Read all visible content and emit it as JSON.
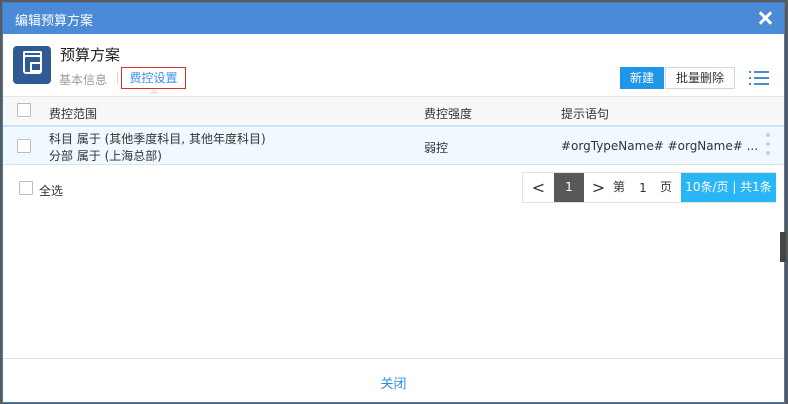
{
  "dialog": {
    "title": "编辑预算方案",
    "close_icon": "close-icon"
  },
  "header": {
    "page_title": "预算方案",
    "tabs": [
      {
        "label": "基本信息",
        "active": false
      },
      {
        "label": "费控设置",
        "active": true
      }
    ],
    "new_button": "新建",
    "batch_delete_button": "批量删除",
    "menu_icon": "list-menu-icon"
  },
  "table": {
    "columns": [
      "费控范围",
      "费控强度",
      "提示语句"
    ],
    "rows": [
      {
        "scope_line1": "科目 属于 (其他季度科目, 其他年度科目)",
        "scope_line2": "分部 属于 (上海总部)",
        "strength": "弱控",
        "prompt": "#orgTypeName# #orgName# ..."
      }
    ],
    "select_all": "全选"
  },
  "pagination": {
    "prev": "<",
    "current_page": "1",
    "next": ">",
    "label_before": "第",
    "page_input": "1",
    "label_after": "页",
    "summary": "10条/页 | 共1条"
  },
  "footer": {
    "close_label": "关闭"
  },
  "colors": {
    "titlebar": "#4a8ad6",
    "primary_button": "#2196e9",
    "active_tab_border": "#d9302c",
    "pager_size": "#29b6f6"
  }
}
